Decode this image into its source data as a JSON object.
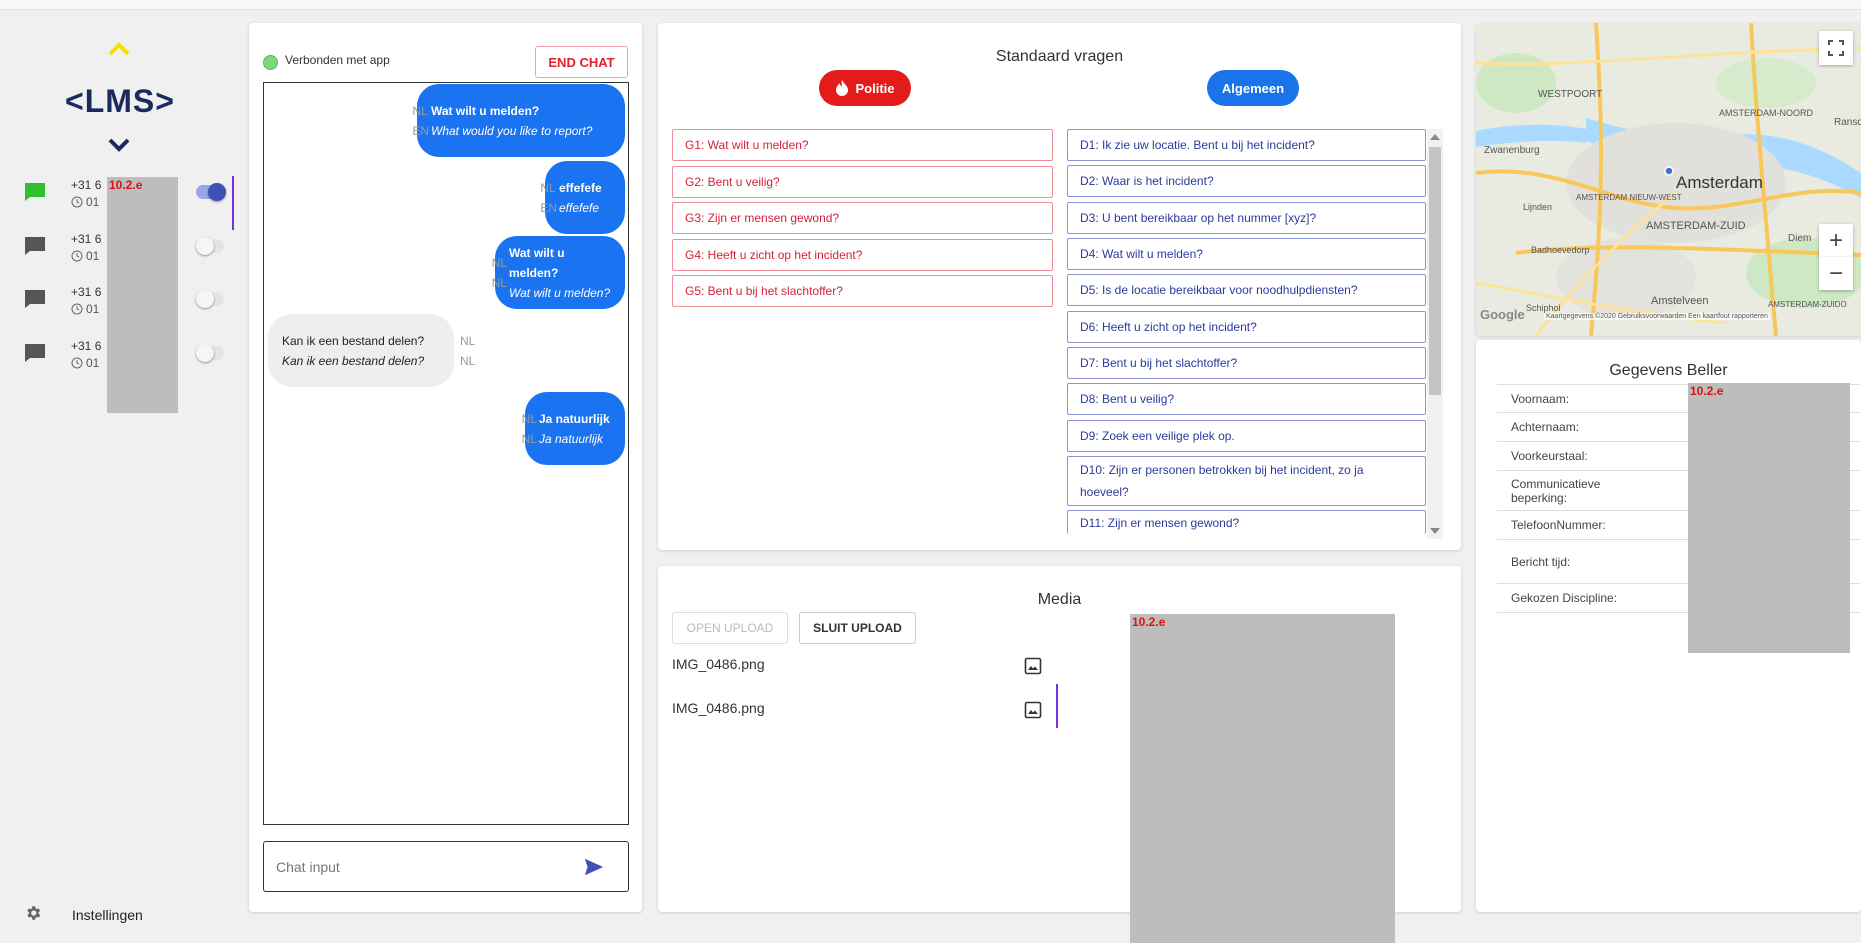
{
  "sidebar": {
    "logo": "<LMS>",
    "callers": [
      {
        "number": "+31 6",
        "time": "01",
        "active": true,
        "icon_color": "#2ec02e"
      },
      {
        "number": "+31 6",
        "time": "01",
        "active": false,
        "icon_color": "#555555"
      },
      {
        "number": "+31 6",
        "time": "01",
        "active": false,
        "icon_color": "#555555"
      },
      {
        "number": "+31 6",
        "time": "01",
        "active": false,
        "icon_color": "#555555"
      }
    ],
    "redaction_tag": "10.2.e",
    "settings_label": "Instellingen"
  },
  "chat": {
    "status_label": "Verbonden met app",
    "end_chat_label": "END CHAT",
    "messages": [
      {
        "direction": "out",
        "lang1": "NL",
        "lang2": "EN",
        "text1": "Wat wilt u melden?",
        "text2": "What would you like to report?"
      },
      {
        "direction": "out",
        "lang1": "NL",
        "lang2": "EN",
        "text1": "effefefe",
        "text2": "effefefe"
      },
      {
        "direction": "out",
        "lang1": "NL",
        "lang2": "NL",
        "text1": "Wat wilt u melden?",
        "text2": "Wat wilt u melden?"
      },
      {
        "direction": "in",
        "lang1": "NL",
        "lang2": "NL",
        "text1": "Kan ik een bestand delen?",
        "text2": "Kan ik een bestand delen?"
      },
      {
        "direction": "out",
        "lang1": "NL",
        "lang2": "NL",
        "text1": "Ja natuurlijk",
        "text2": "Ja natuurlijk"
      }
    ],
    "input_placeholder": "Chat input"
  },
  "questions": {
    "title": "Standaard vragen",
    "politie_label": "Politie",
    "algemeen_label": "Algemeen",
    "politie_items": [
      "G1: Wat wilt u melden?",
      "G2: Bent u veilig?",
      "G3: Zijn er mensen gewond?",
      "G4: Heeft u zicht op het incident?",
      "G5: Bent u bij het slachtoffer?"
    ],
    "algemeen_items": [
      "D1: Ik zie uw locatie. Bent u bij het incident?",
      "D2: Waar is het incident?",
      "D3: U bent bereikbaar op het nummer [xyz]?",
      "D4: Wat wilt u melden?",
      "D5: Is de locatie bereikbaar voor noodhulpdiensten?",
      "D6: Heeft u zicht op het incident?",
      "D7: Bent u bij het slachtoffer?",
      "D8: Bent u veilig?",
      "D9: Zoek een veilige plek op.",
      "D10: Zijn er personen betrokken bij het incident, zo ja hoeveel?",
      "D11: Zijn er mensen gewond?"
    ]
  },
  "media": {
    "title": "Media",
    "open_upload_label": "OPEN UPLOAD",
    "close_upload_label": "SLUIT UPLOAD",
    "files": [
      "IMG_0486.png",
      "IMG_0486.png"
    ],
    "redaction_tag": "10.2.e"
  },
  "map": {
    "city": "Amsterdam",
    "labels": {
      "westpoort": "WESTPOORT",
      "noord": "AMSTERDAM-NOORD",
      "ransd": "Ransd",
      "zwanenburg": "Zwanenburg",
      "nieuw_west": "AMSTERDAM NIEUW-WEST",
      "lijnden": "Lijnden",
      "zuid": "AMSTERDAM-ZUID",
      "badhoevedorp": "Badhoevedorp",
      "diem": "Diem",
      "amstelveen": "Amstelveen",
      "schiphol": "Schiphol",
      "zuidoost": "AMSTERDAM-ZUIDO",
      "attribution": "Kaartgegevens ©2020  Gebruiksvoorwaarden  Een kaartfout rapporteren",
      "google": "Google"
    },
    "zoom_in": "+",
    "zoom_out": "−"
  },
  "caller_info": {
    "title": "Gegevens Beller",
    "fields": [
      "Voornaam:",
      "Achternaam:",
      "Voorkeurstaal:",
      "Communicatieve beperking:",
      "TelefoonNummer:",
      "Bericht tijd:",
      "Gekozen Discipline:"
    ],
    "redaction_tag": "10.2.e"
  }
}
